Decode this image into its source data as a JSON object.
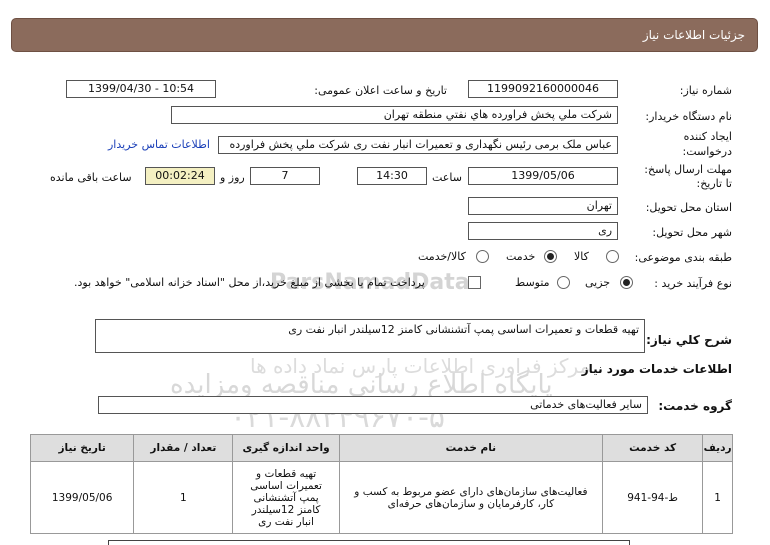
{
  "header": {
    "title": "جزئیات اطلاعات نیاز"
  },
  "form": {
    "need_number_label": "شماره نیاز:",
    "need_number": "1199092160000046",
    "announce_label": "تاریخ و ساعت اعلان عمومی:",
    "announce_value": "1399/04/30 - 10:54",
    "buyer_label": "نام دستگاه خریدار:",
    "buyer_value": "شرکت ملي پخش فراورده هاي نفتي منطقه تهران",
    "creator_label_1": "ایجاد کننده",
    "creator_label_2": "درخواست:",
    "creator_value": "عباس ملک برمی رئیس نگهداری و تعمیرات انبار نفت ری شرکت ملي پخش فراورده",
    "contact_link": "اطلاعات تماس خریدار",
    "deadline_label_1": "مهلت ارسال پاسخ:",
    "deadline_label_2": "تا تاریخ:",
    "deadline_date": "1399/05/06",
    "time_label": "ساعت",
    "deadline_time": "14:30",
    "days_value": "7",
    "days_label": "روز و",
    "remaining_time": "00:02:24",
    "remaining_label": "ساعت باقی مانده",
    "province_label": "استان محل تحویل:",
    "province_value": "تهران",
    "city_label": "شهر محل تحویل:",
    "city_value": "ری",
    "category_label": "طبقه بندی موضوعی:",
    "category_options": [
      "کالا",
      "خدمت",
      "کالا/خدمت"
    ],
    "category_selected": "خدمت",
    "process_label": "نوع فرآیند خرید :",
    "process_options": [
      "جزیی",
      "متوسط"
    ],
    "process_selected": "جزیی",
    "payment_text": "پرداخت تمام یا بخشی از مبلغ خرید،از محل \"اسناد خزانه اسلامی\" خواهد بود."
  },
  "description": {
    "label": "شرح کلي نياز:",
    "value": "تهیه قطعات و تعمیرات اساسی پمپ آتشنشانی کامنز 12سیلندر انبار نفت ری"
  },
  "services": {
    "section_title": "اطلاعات خدمات مورد نیاز",
    "group_label": "گروه خدمت:",
    "group_value": "سایر فعالیت‌های خدماتی",
    "columns": [
      "ردیف",
      "کد خدمت",
      "نام خدمت",
      "واحد اندازه گیری",
      "تعداد / مقدار",
      "تاریخ نیاز"
    ],
    "rows": [
      {
        "row": "1",
        "code": "ط-94-941",
        "name": "فعالیت‌های سازمان‌های دارای عضو مربوط به کسب و کار، کارفرمایان و سازمان‌های حرفه‌ای",
        "unit": "تهیه قطعات و تعمیرات اساسی پمپ آتشنشانی کامنز 12سیلندر انبار نفت ری",
        "qty": "1",
        "date": "1399/05/06"
      }
    ]
  },
  "watermark": {
    "brand": "ParsNamadData",
    "line1": "مرکز فراوری اطلاعات پارس نماد داده ها",
    "line2": "پایگاه اطلاع رسانی مناقصه ومزایده",
    "phone": "۰۲۱-۸۸۳۴۹۶۷۰-۵"
  },
  "colors": {
    "header_bg": "#8b6b5c",
    "link": "#1a3fb8",
    "timer_bg": "#f4f0c2"
  }
}
